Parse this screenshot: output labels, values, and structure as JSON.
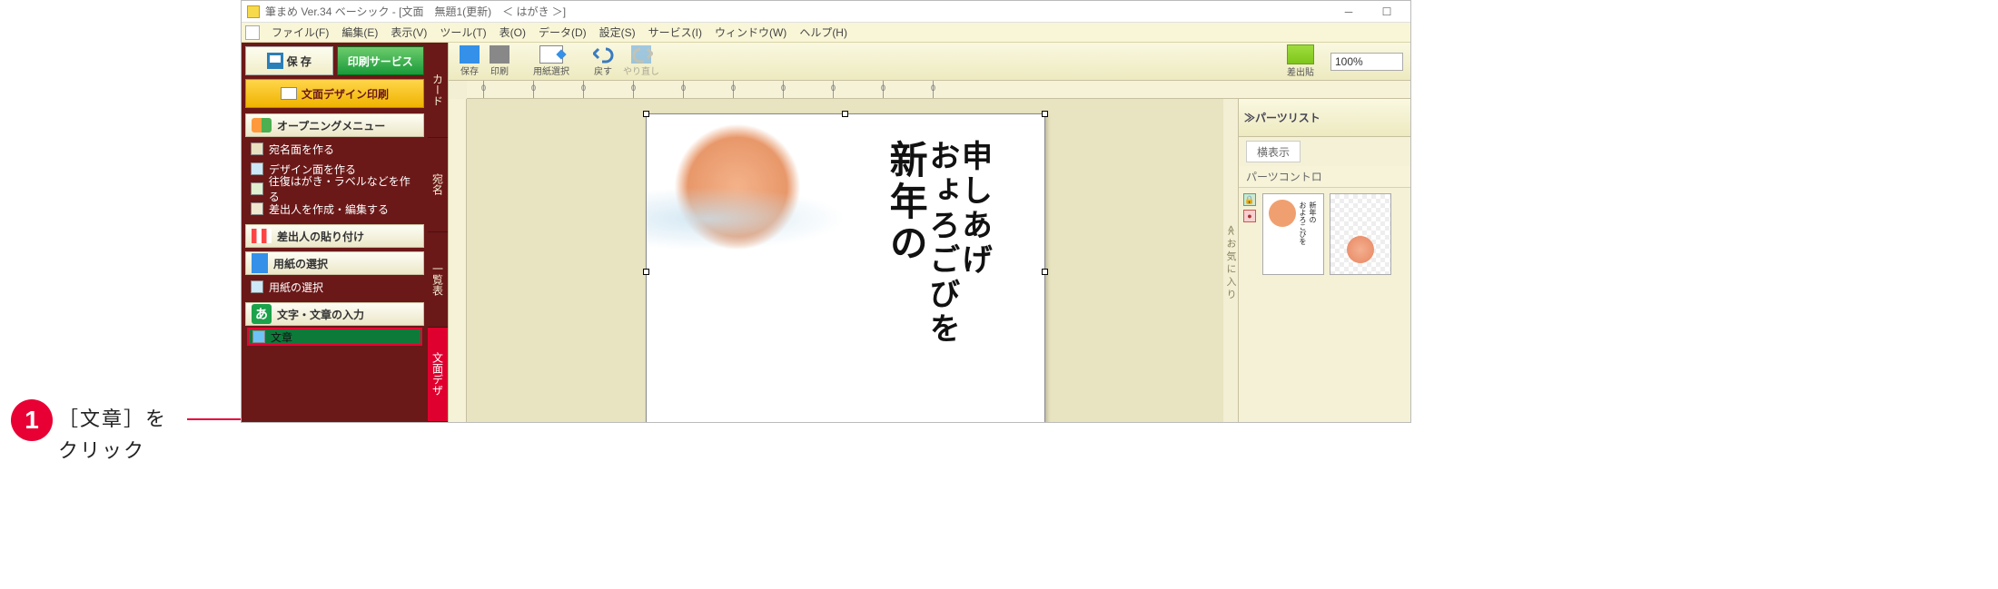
{
  "callout": {
    "num": "1",
    "text_l1": "［文章］を",
    "text_l2": "クリック"
  },
  "titlebar": {
    "title": "筆まめ Ver.34 ベーシック - [文面　無題1(更新)　＜ はがき ＞]"
  },
  "menubar": {
    "items": [
      "ファイル(F)",
      "編集(E)",
      "表示(V)",
      "ツール(T)",
      "表(O)",
      "データ(D)",
      "設定(S)",
      "サービス(I)",
      "ウィンドウ(W)",
      "ヘルプ(H)"
    ]
  },
  "left_panel": {
    "save": "保 存",
    "print_service": "印刷サービス",
    "design_print": "文面デザイン印刷",
    "sec_opening": "オープニングメニュー",
    "opening_items": [
      "宛名面を作る",
      "デザイン面を作る",
      "往復はがき・ラベルなどを作る",
      "差出人を作成・編集する"
    ],
    "sec_sender": "差出人の貼り付け",
    "sec_paper": "用紙の選択",
    "paper_items": [
      "用紙の選択"
    ],
    "sec_text": "文字・文章の入力",
    "text_items": [
      "文章"
    ]
  },
  "vertical_tabs": [
    "カード",
    "宛名",
    "一覧表",
    "文面デザ"
  ],
  "toolbar": {
    "save": "保存",
    "print": "印刷",
    "paper": "用紙選択",
    "undo": "戻す",
    "redo": "やり直し",
    "sticky": "差出貼",
    "zoom": "100%"
  },
  "canvas": {
    "favorites_label": "≪お気に入り",
    "brush_col1": "新年の",
    "brush_col2": "おょろごびを",
    "brush_col3": "申しあげ"
  },
  "right_panel": {
    "title": "≫パーツリスト",
    "subtab": "横表示",
    "control_label": "パーツコントロ"
  }
}
